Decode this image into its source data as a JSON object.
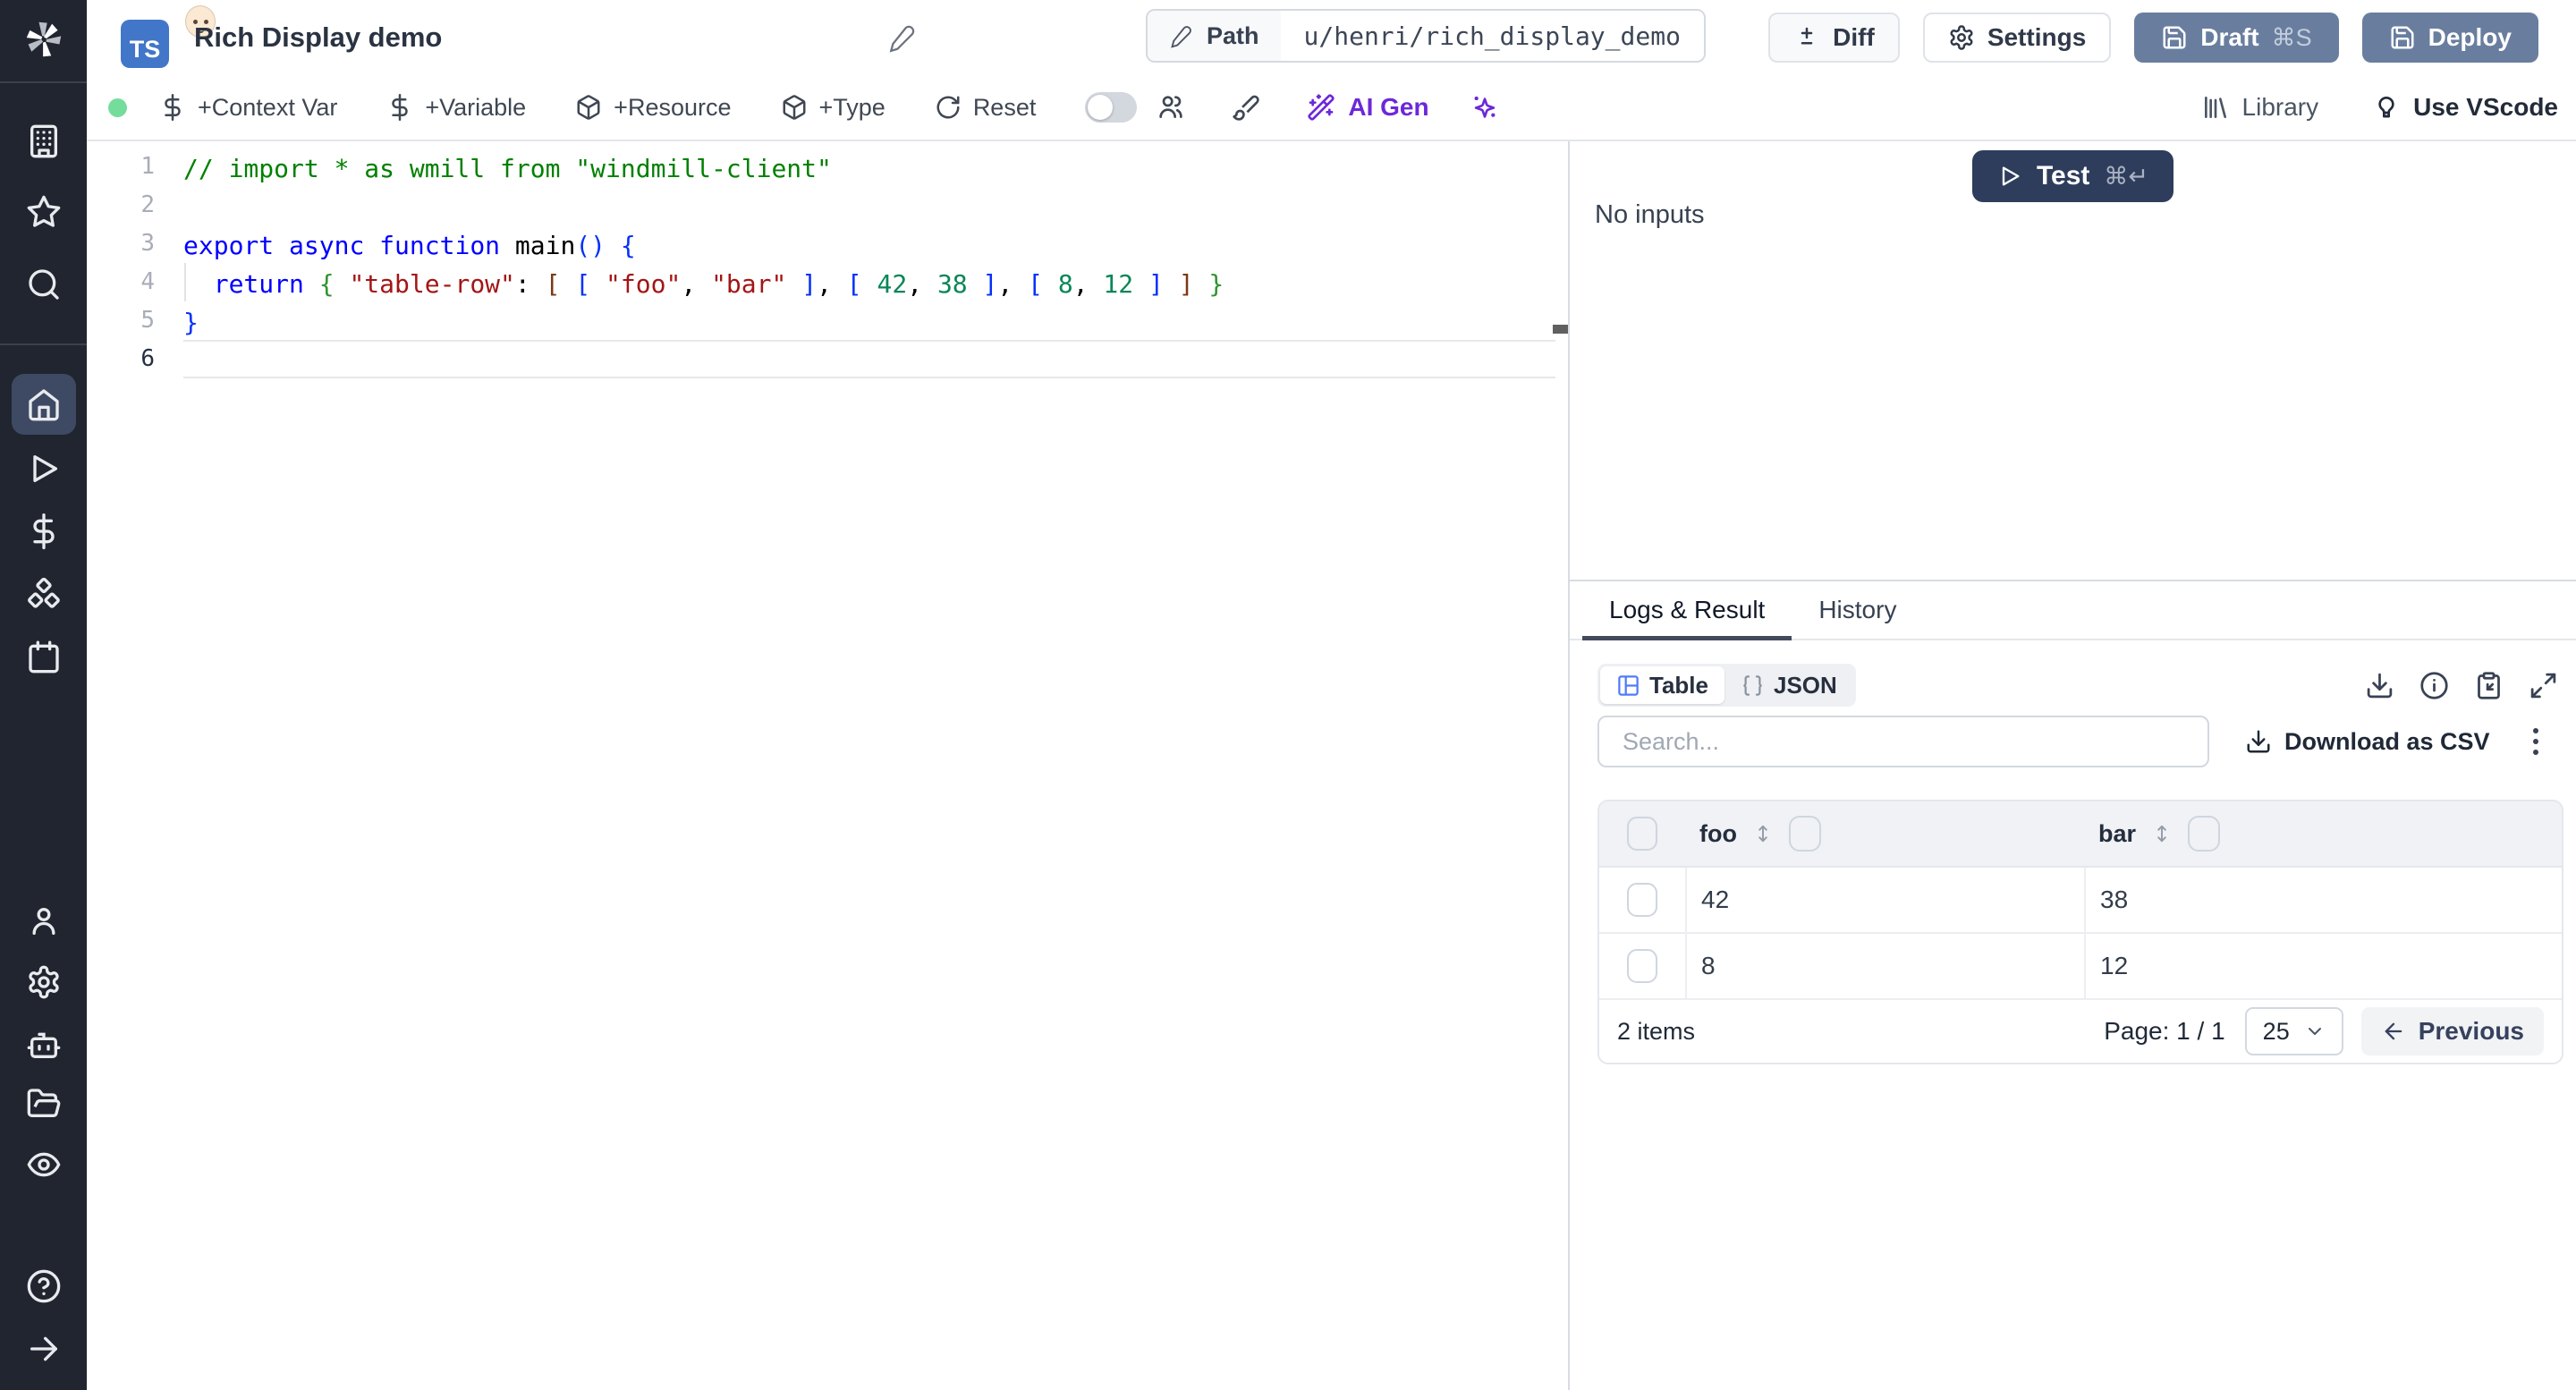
{
  "header": {
    "lang_badge": "TS",
    "badge_emoji": "👶",
    "title": "Rich Display demo",
    "path_label": "Path",
    "path_value": "u/henri/rich_display_demo",
    "diff_label": "Diff",
    "settings_label": "Settings",
    "draft_label": "Draft",
    "draft_shortcut": "⌘S",
    "deploy_label": "Deploy"
  },
  "toolbar": {
    "context_var": "+Context Var",
    "variable": "+Variable",
    "resource": "+Resource",
    "type": "+Type",
    "reset": "Reset",
    "ai_gen": "AI Gen",
    "library": "Library",
    "use_vscode": "Use VScode"
  },
  "editor": {
    "active_line": 6,
    "lines": [
      [
        {
          "t": "// import * as wmill from \"windmill-client\"",
          "c": "c"
        }
      ],
      [],
      [
        {
          "t": "export",
          "c": "k"
        },
        {
          "t": " ",
          "c": "p"
        },
        {
          "t": "async",
          "c": "k"
        },
        {
          "t": " ",
          "c": "p"
        },
        {
          "t": "function",
          "c": "k"
        },
        {
          "t": " ",
          "c": "p"
        },
        {
          "t": "main",
          "c": "p"
        },
        {
          "t": "()",
          "c": "b"
        },
        {
          "t": " ",
          "c": "p"
        },
        {
          "t": "{",
          "c": "b"
        }
      ],
      [
        {
          "t": "  ",
          "c": "p"
        },
        {
          "t": "return",
          "c": "k"
        },
        {
          "t": " ",
          "c": "p"
        },
        {
          "t": "{",
          "c": "g"
        },
        {
          "t": " ",
          "c": "p"
        },
        {
          "t": "\"table-row\"",
          "c": "s"
        },
        {
          "t": ": ",
          "c": "p"
        },
        {
          "t": "[",
          "c": "o"
        },
        {
          "t": " ",
          "c": "p"
        },
        {
          "t": "[",
          "c": "b"
        },
        {
          "t": " ",
          "c": "p"
        },
        {
          "t": "\"foo\"",
          "c": "s"
        },
        {
          "t": ", ",
          "c": "p"
        },
        {
          "t": "\"bar\"",
          "c": "s"
        },
        {
          "t": " ",
          "c": "p"
        },
        {
          "t": "]",
          "c": "b"
        },
        {
          "t": ", ",
          "c": "p"
        },
        {
          "t": "[",
          "c": "b"
        },
        {
          "t": " ",
          "c": "p"
        },
        {
          "t": "42",
          "c": "n"
        },
        {
          "t": ", ",
          "c": "p"
        },
        {
          "t": "38",
          "c": "n"
        },
        {
          "t": " ",
          "c": "p"
        },
        {
          "t": "]",
          "c": "b"
        },
        {
          "t": ", ",
          "c": "p"
        },
        {
          "t": "[",
          "c": "b"
        },
        {
          "t": " ",
          "c": "p"
        },
        {
          "t": "8",
          "c": "n"
        },
        {
          "t": ", ",
          "c": "p"
        },
        {
          "t": "12",
          "c": "n"
        },
        {
          "t": " ",
          "c": "p"
        },
        {
          "t": "]",
          "c": "b"
        },
        {
          "t": " ",
          "c": "p"
        },
        {
          "t": "]",
          "c": "o"
        },
        {
          "t": " ",
          "c": "p"
        },
        {
          "t": "}",
          "c": "g"
        }
      ],
      [
        {
          "t": "}",
          "c": "b"
        }
      ],
      []
    ]
  },
  "run_panel": {
    "test_label": "Test",
    "test_shortcut": "⌘↵",
    "no_inputs": "No inputs",
    "tab_logs": "Logs & Result",
    "tab_history": "History",
    "view_table": "Table",
    "view_json": "JSON",
    "search_placeholder": "Search...",
    "download_csv": "Download as CSV",
    "table": {
      "columns": [
        "foo",
        "bar"
      ],
      "rows": [
        [
          "42",
          "38"
        ],
        [
          "8",
          "12"
        ]
      ],
      "items_count": "2 items",
      "page_indicator": "Page: 1 / 1",
      "page_size": "25",
      "previous_label": "Previous"
    }
  },
  "colors": {
    "sidebar_bg": "#20252f",
    "active_tile": "#3e4a63",
    "slate_button": "#697e9f",
    "test_button": "#2f3d5c",
    "accent_purple": "#6d28d9",
    "status_green": "#74dd9b",
    "ts_badge_blue": "#4276c9",
    "table_icon_blue": "#4f7cf7"
  }
}
